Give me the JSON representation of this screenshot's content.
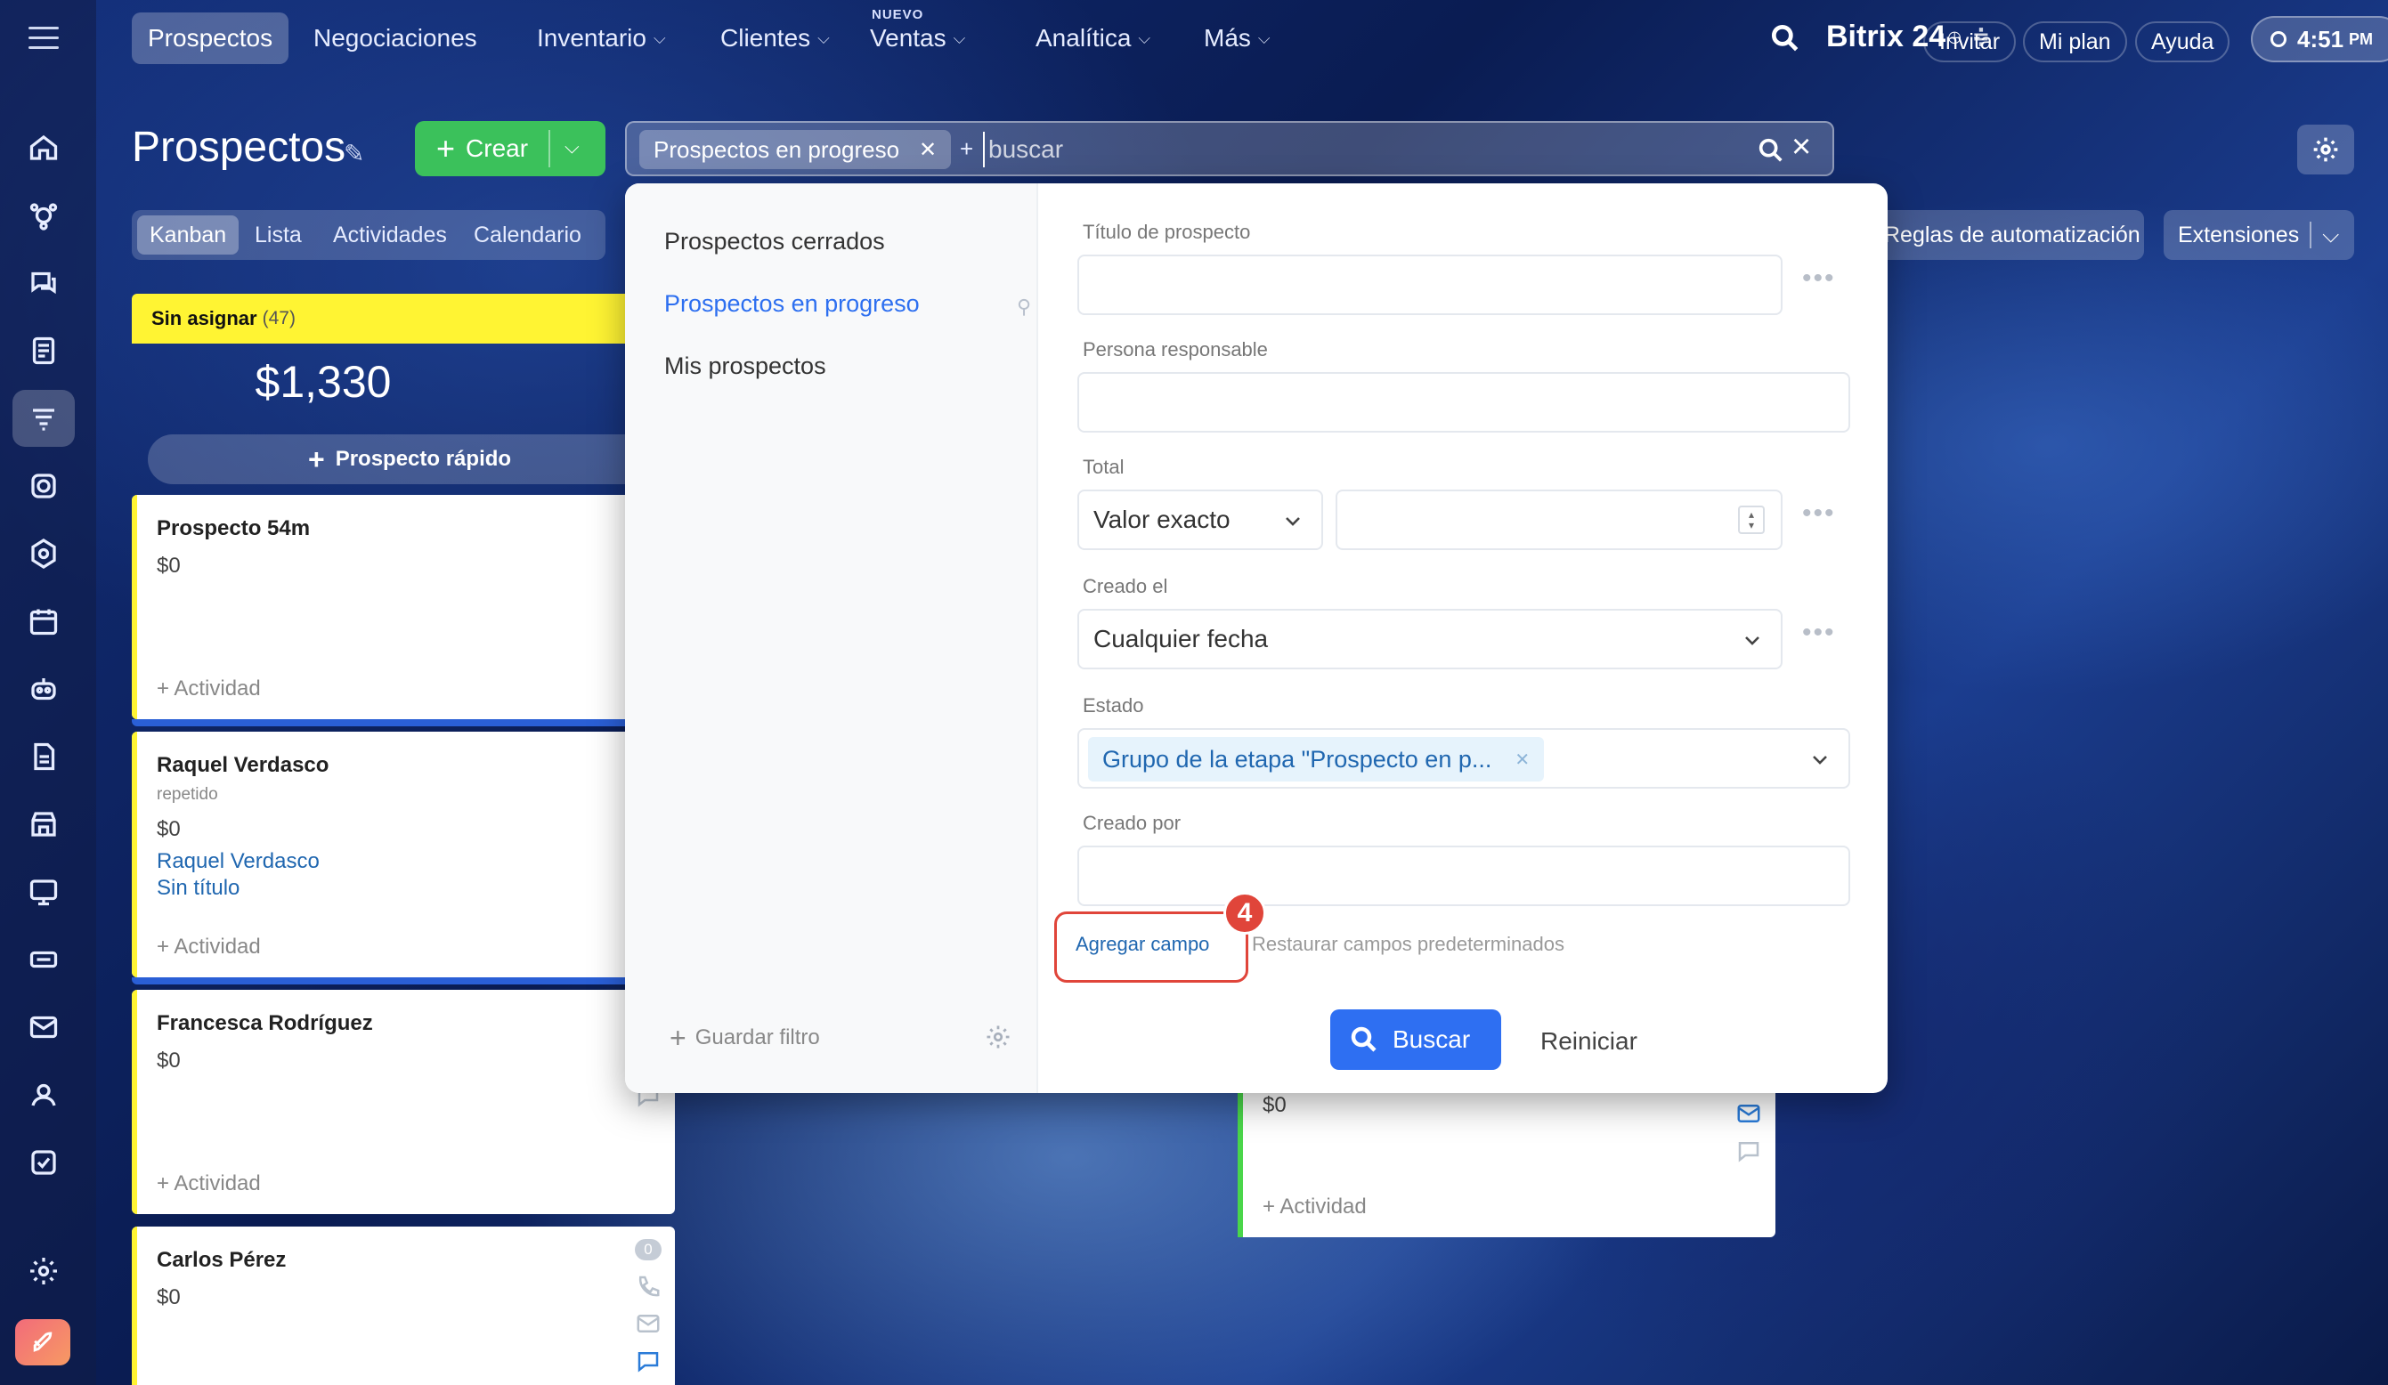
{
  "topnav": {
    "items": [
      {
        "label": "Prospectos",
        "active": true,
        "chevron": false
      },
      {
        "label": "Negociaciones",
        "active": false,
        "chevron": false
      },
      {
        "label": "Inventario",
        "active": false,
        "chevron": true
      },
      {
        "label": "Clientes",
        "active": false,
        "chevron": true
      },
      {
        "label": "Ventas",
        "active": false,
        "chevron": true,
        "badge": "NUEVO"
      },
      {
        "label": "Analítica",
        "active": false,
        "chevron": true
      },
      {
        "label": "Más",
        "active": false,
        "chevron": true
      }
    ],
    "brand": "Bitrix 24",
    "invite": "Invitar",
    "plan": "Mi plan",
    "help": "Ayuda",
    "time": "4:51",
    "time_suffix": "PM"
  },
  "toolbar": {
    "title": "Prospectos",
    "create_label": "Crear",
    "filter_chip": "Prospectos en progreso",
    "search_placeholder": "buscar",
    "view_tabs": [
      "Kanban",
      "Lista",
      "Actividades",
      "Calendario"
    ],
    "automation_rules": "Reglas de automatización",
    "extensions": "Extensiones"
  },
  "kanban": {
    "column": {
      "title": "Sin asignar",
      "count": "(47)",
      "total": "$1,330",
      "quick_add": "Prospecto rápido"
    },
    "cards": [
      {
        "title": "Prospecto 54m",
        "amount": "$0",
        "activity": "+ Actividad"
      },
      {
        "title": "Raquel Verdasco",
        "sub": "repetido",
        "amount": "$0",
        "link1": "Raquel Verdasco",
        "link2": "Sin título",
        "activity": "+ Actividad"
      },
      {
        "title": "Francesca Rodríguez",
        "amount": "$0",
        "activity": "+ Actividad"
      },
      {
        "title": "Carlos Pérez",
        "amount": "$0",
        "badge": "0"
      }
    ],
    "card3": {
      "amount": "$0",
      "activity": "+ Actividad"
    }
  },
  "filter": {
    "presets": [
      "Prospectos cerrados",
      "Prospectos en progreso",
      "Mis prospectos"
    ],
    "active_preset": 1,
    "save_filter": "Guardar filtro",
    "fields": {
      "title_label": "Título de prospecto",
      "responsible_label": "Persona responsable",
      "total_label": "Total",
      "total_select": "Valor exacto",
      "created_label": "Creado el",
      "created_select": "Cualquier fecha",
      "status_label": "Estado",
      "status_tag": "Grupo de la etapa \"Prospecto en p...",
      "created_by_label": "Creado por"
    },
    "add_field": "Agregar campo",
    "step_number": "4",
    "restore_defaults": "Restaurar campos predeterminados",
    "search_button": "Buscar",
    "reset_button": "Reiniciar"
  },
  "colors": {
    "accent_blue": "#2e6ff2",
    "create_green": "#3bc15b",
    "column_yellow": "#fff433",
    "highlight_red": "#e0453a"
  }
}
